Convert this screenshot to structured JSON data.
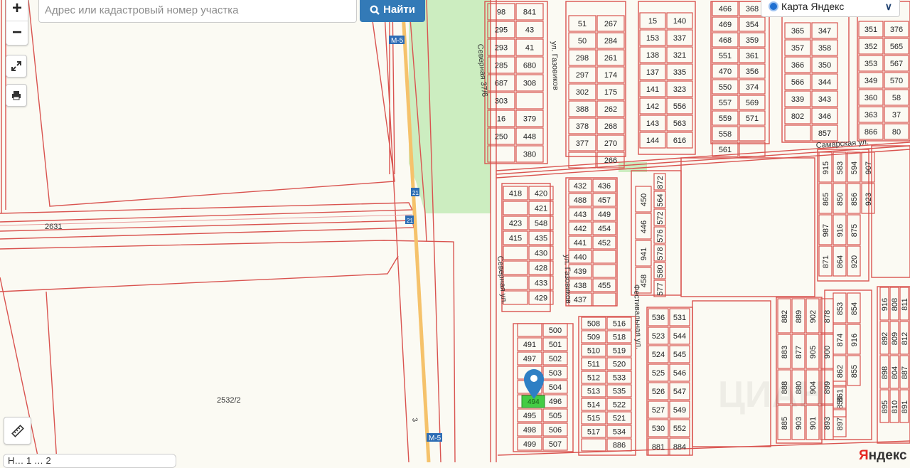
{
  "search": {
    "placeholder": "Адрес или кадастровый номер участка",
    "button_label": "Найти"
  },
  "zoom": {
    "in_label": "+",
    "out_label": "−"
  },
  "layer_select": {
    "label": "Карта Яндекс"
  },
  "scale_text": "Н… 1 … 2",
  "attribution": {
    "ya": "Я",
    "rest": "ндекс"
  },
  "roads": {
    "m5": "М-5",
    "m5_marker": "21",
    "road_3": "3"
  },
  "streets": [
    "Северная ул.",
    "ул. Газовиков",
    "ул. Газовиков",
    "Фестивальная ул.",
    "Самарская ул.",
    "Северная 37/6"
  ],
  "big_parcels": [
    "2631",
    "2532/2"
  ],
  "watermark": "ЦИАН",
  "colors": {
    "parcel": "#d9534f",
    "park": "#ccedc0",
    "selected": "#44cc44",
    "marker": "#2e7fc4",
    "background": "#fbfaf3",
    "accent": "#337ab7"
  },
  "parcels": {
    "block_a": [
      [
        "98",
        "841"
      ],
      [
        "295",
        "43"
      ],
      [
        "293",
        "41"
      ],
      [
        "285",
        "680"
      ],
      [
        "687",
        "308"
      ],
      [
        "303",
        ""
      ],
      [
        "16",
        "379"
      ],
      [
        "250",
        "448"
      ],
      [
        "",
        "380"
      ]
    ],
    "block_b": [
      [
        "51",
        "267"
      ],
      [
        "50",
        "284"
      ],
      [
        "298",
        "261"
      ],
      [
        "297",
        "174"
      ],
      [
        "302",
        "175"
      ],
      [
        "388",
        "262"
      ],
      [
        "378",
        "268"
      ],
      [
        "377",
        "270"
      ],
      [
        "",
        "266"
      ]
    ],
    "block_c": [
      [
        "15",
        "140"
      ],
      [
        "153",
        "337"
      ],
      [
        "138",
        "321"
      ],
      [
        "137",
        "335"
      ],
      [
        "141",
        "323"
      ],
      [
        "142",
        "556"
      ],
      [
        "143",
        "563"
      ],
      [
        "144",
        "616"
      ]
    ],
    "block_d": [
      [
        "466",
        "368"
      ],
      [
        "469",
        "354"
      ],
      [
        "468",
        "359"
      ],
      [
        "551",
        "361"
      ],
      [
        "470",
        "356"
      ],
      [
        "550",
        "374"
      ],
      [
        "557",
        "569"
      ],
      [
        "559",
        "571"
      ],
      [
        "558",
        ""
      ],
      [
        "561",
        ""
      ]
    ],
    "block_e": [
      [
        "365",
        "347"
      ],
      [
        "357",
        "358"
      ],
      [
        "366",
        "350"
      ],
      [
        "566",
        "344"
      ],
      [
        "339",
        "343"
      ],
      [
        "802",
        "346"
      ],
      [
        "",
        "857"
      ]
    ],
    "block_f": [
      [
        "351",
        "376"
      ],
      [
        "352",
        "565"
      ],
      [
        "353",
        "567"
      ],
      [
        "349",
        "570"
      ],
      [
        "360",
        "58"
      ],
      [
        "363",
        "37"
      ],
      [
        "866",
        "80"
      ]
    ],
    "block_g": [
      [
        "418",
        "420"
      ],
      [
        "",
        "421"
      ],
      [
        "423",
        "548"
      ],
      [
        "415",
        "435"
      ],
      [
        "",
        "430"
      ],
      [
        "",
        "428"
      ],
      [
        "",
        "433"
      ],
      [
        "",
        "429"
      ]
    ],
    "block_h": [
      [
        "432",
        "436"
      ],
      [
        "488",
        "457"
      ],
      [
        "443",
        "449"
      ],
      [
        "442",
        "454"
      ],
      [
        "441",
        "452"
      ],
      [
        "440",
        ""
      ],
      [
        "439",
        ""
      ],
      [
        "438",
        "455"
      ],
      [
        "437",
        ""
      ]
    ],
    "block_i": [
      "450",
      "446",
      "941",
      "458"
    ],
    "block_i2": [
      "872",
      "564",
      "572",
      "576",
      "578",
      "580",
      "577"
    ],
    "block_j": [
      [
        "",
        "500"
      ],
      [
        "491",
        "501"
      ],
      [
        "497",
        "502"
      ],
      [
        "",
        "503"
      ],
      [
        "",
        "504"
      ],
      [
        "",
        "496"
      ],
      [
        "495",
        "505"
      ],
      [
        "498",
        "506"
      ],
      [
        "499",
        "507"
      ]
    ],
    "block_k": [
      [
        "508",
        "516"
      ],
      [
        "509",
        "518"
      ],
      [
        "510",
        "519"
      ],
      [
        "511",
        "520"
      ],
      [
        "512",
        "533"
      ],
      [
        "513",
        "535"
      ],
      [
        "514",
        "522"
      ],
      [
        "515",
        "521"
      ],
      [
        "517",
        "534"
      ],
      [
        "",
        "886"
      ]
    ],
    "block_l": [
      [
        "536",
        "531"
      ],
      [
        "523",
        "544"
      ],
      [
        "524",
        "545"
      ],
      [
        "525",
        "546"
      ],
      [
        "526",
        "547"
      ],
      [
        "527",
        "549"
      ],
      [
        "530",
        "552"
      ],
      [
        "881",
        "884"
      ]
    ],
    "block_m": [
      "882",
      "883",
      "888",
      "885",
      "889",
      "877",
      "880",
      "903",
      "902",
      "905",
      "904",
      "901",
      "878",
      "900",
      "899",
      "893"
    ],
    "block_n": [
      "915",
      "865",
      "987",
      "871",
      "583",
      "850",
      "916",
      "864",
      "594",
      "856",
      "875",
      "920",
      "907",
      "923",
      "853",
      "874",
      "862",
      "859",
      "854",
      "916",
      "855",
      "861",
      "897",
      "916",
      "892",
      "898",
      "895",
      "808",
      "809",
      "804",
      "810",
      "811",
      "812",
      "887",
      "891"
    ],
    "selected": "494"
  }
}
